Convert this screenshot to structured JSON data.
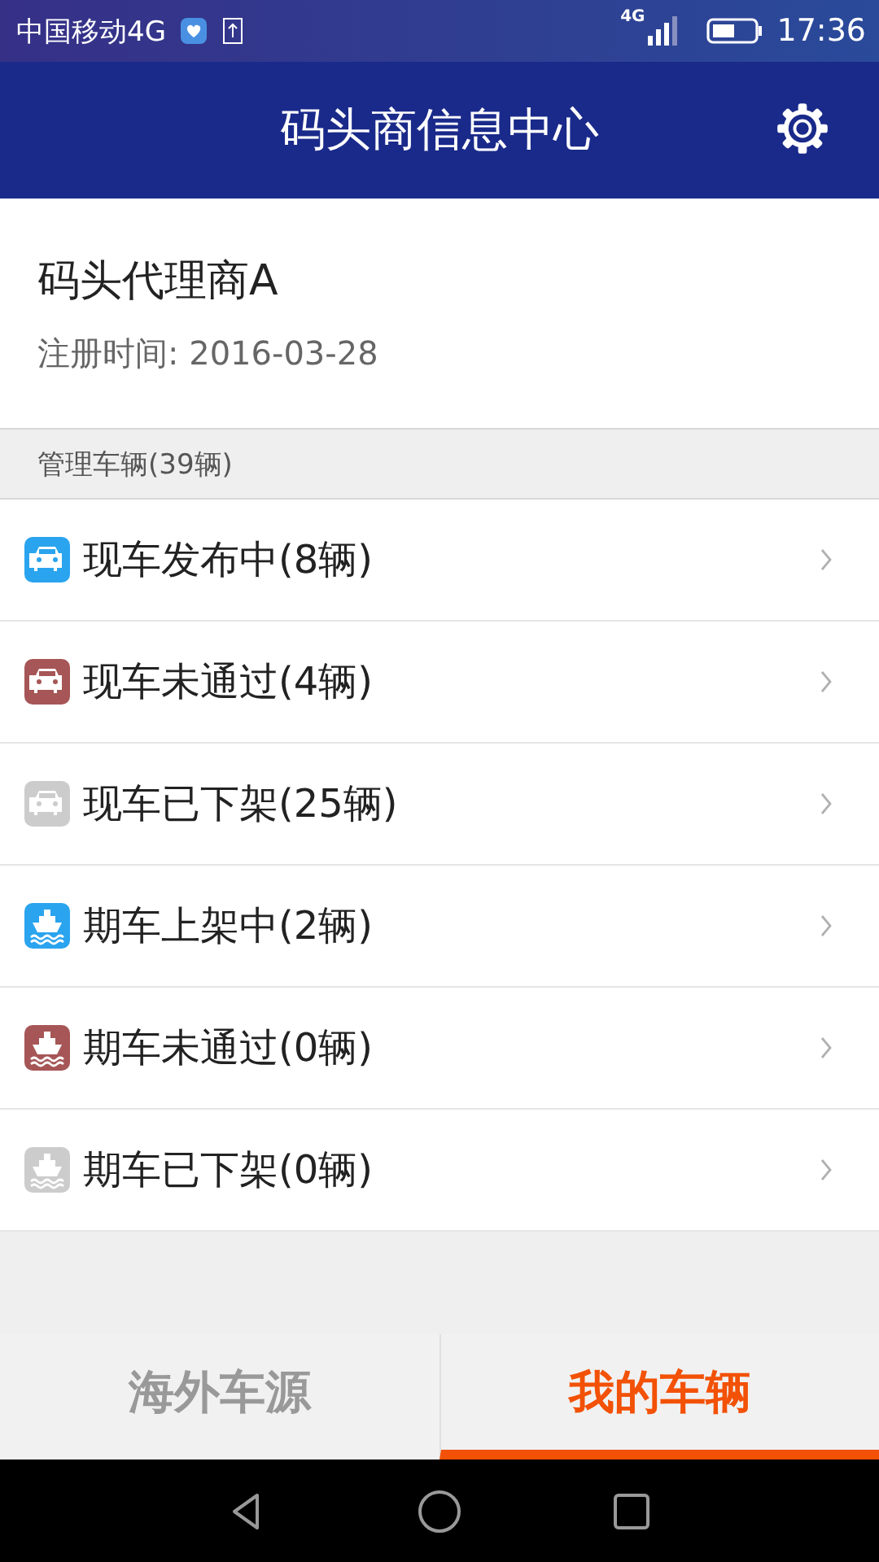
{
  "status_bar": {
    "carrier": "中国移动4G",
    "network": "4G",
    "time": "17:36"
  },
  "header": {
    "title": "码头商信息中心"
  },
  "profile": {
    "name": "码头代理商A",
    "registered": "注册时间: 2016-03-28"
  },
  "section": {
    "title": "管理车辆(39辆)"
  },
  "items": [
    {
      "kind": "car",
      "color": "#2aa4ee",
      "label": "现车发布中(8辆)"
    },
    {
      "kind": "car",
      "color": "#a65656",
      "label": "现车未通过(4辆)"
    },
    {
      "kind": "car",
      "color": "#cccccc",
      "label": "现车已下架(25辆)"
    },
    {
      "kind": "ship",
      "color": "#2aa4ee",
      "label": "期车上架中(2辆)"
    },
    {
      "kind": "ship",
      "color": "#a65656",
      "label": "期车未通过(0辆)"
    },
    {
      "kind": "ship",
      "color": "#cccccc",
      "label": "期车已下架(0辆)"
    }
  ],
  "tabs": [
    {
      "label": "海外车源",
      "selected": false
    },
    {
      "label": "我的车辆",
      "selected": true
    }
  ]
}
